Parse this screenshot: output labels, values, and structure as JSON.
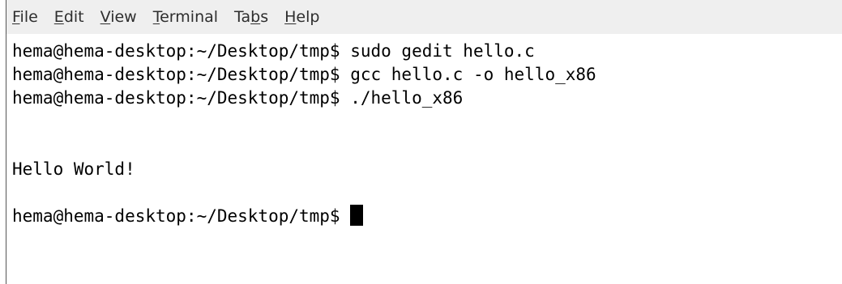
{
  "menubar": {
    "items": [
      {
        "label": "File",
        "mnemonic": "F",
        "rest": "ile"
      },
      {
        "label": "Edit",
        "mnemonic": "E",
        "rest": "dit"
      },
      {
        "label": "View",
        "mnemonic": "V",
        "rest": "iew"
      },
      {
        "label": "Terminal",
        "mnemonic": "T",
        "rest": "erminal"
      },
      {
        "label": "Tabs",
        "pre": "Ta",
        "mnemonic": "b",
        "rest": "s"
      },
      {
        "label": "Help",
        "mnemonic": "H",
        "rest": "elp"
      }
    ]
  },
  "terminal": {
    "prompt": "hema@hema-desktop:~/Desktop/tmp$ ",
    "lines": [
      "hema@hema-desktop:~/Desktop/tmp$ sudo gedit hello.c",
      "hema@hema-desktop:~/Desktop/tmp$ gcc hello.c -o hello_x86",
      "hema@hema-desktop:~/Desktop/tmp$ ./hello_x86",
      "",
      "",
      "Hello World!",
      ""
    ]
  }
}
